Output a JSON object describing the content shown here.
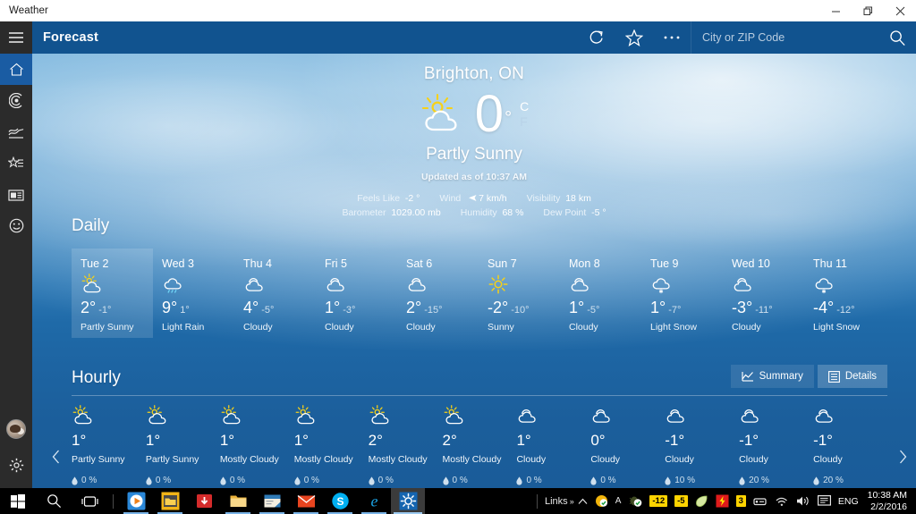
{
  "window": {
    "title": "Weather",
    "minimize_label": "Minimize",
    "restore_label": "Restore",
    "close_label": "Close"
  },
  "appbar": {
    "title": "Forecast",
    "hamburger_name": "hamburger-menu-icon",
    "refresh_name": "refresh-icon",
    "favorite_name": "star-icon",
    "more_name": "ellipsis-icon",
    "search_name": "search-icon"
  },
  "search": {
    "placeholder": "City or ZIP Code",
    "value": ""
  },
  "rail": {
    "items": [
      {
        "name": "home",
        "label": "Forecast",
        "icon": "home-icon",
        "active": true
      },
      {
        "name": "maps",
        "label": "Maps",
        "icon": "radar-icon",
        "active": false
      },
      {
        "name": "historical",
        "label": "Historical Weather",
        "icon": "chart-icon",
        "active": false
      },
      {
        "name": "favorites",
        "label": "Places",
        "icon": "star-list-icon",
        "active": false
      },
      {
        "name": "news",
        "label": "News",
        "icon": "news-icon",
        "active": false
      },
      {
        "name": "feedback",
        "label": "Send Feedback",
        "icon": "smiley-icon",
        "active": false
      }
    ],
    "account_name": "account-avatar",
    "settings_name": "gear-icon"
  },
  "current": {
    "city": "Brighton, ON",
    "temperature": "0",
    "degree": "°",
    "unit_selected": "C",
    "unit_alternate": "F",
    "condition": "Partly Sunny",
    "icon": "partly-sunny-icon",
    "updated": "Updated as of 10:37 AM",
    "details": [
      {
        "label": "Feels Like",
        "value": "-2 °"
      },
      {
        "label": "Wind",
        "value": "7 km/h",
        "arrow": true
      },
      {
        "label": "Visibility",
        "value": "18 km"
      },
      {
        "label": "Barometer",
        "value": "1029.00 mb"
      },
      {
        "label": "Humidity",
        "value": "68 %"
      },
      {
        "label": "Dew Point",
        "value": "-5 °"
      }
    ]
  },
  "daily": {
    "heading": "Daily",
    "days": [
      {
        "day": "Tue 2",
        "icon": "partly-sunny-icon",
        "high": "2°",
        "low": "-1°",
        "cond": "Partly Sunny",
        "selected": true
      },
      {
        "day": "Wed 3",
        "icon": "light-rain-icon",
        "high": "9°",
        "low": "1°",
        "cond": "Light Rain",
        "selected": false
      },
      {
        "day": "Thu 4",
        "icon": "cloudy-icon",
        "high": "4°",
        "low": "-5°",
        "cond": "Cloudy",
        "selected": false
      },
      {
        "day": "Fri 5",
        "icon": "cloudy-icon",
        "high": "1°",
        "low": "-3°",
        "cond": "Cloudy",
        "selected": false
      },
      {
        "day": "Sat 6",
        "icon": "cloudy-icon",
        "high": "2°",
        "low": "-15°",
        "cond": "Cloudy",
        "selected": false
      },
      {
        "day": "Sun 7",
        "icon": "sunny-icon",
        "high": "-2°",
        "low": "-10°",
        "cond": "Sunny",
        "selected": false
      },
      {
        "day": "Mon 8",
        "icon": "cloudy-icon",
        "high": "1°",
        "low": "-5°",
        "cond": "Cloudy",
        "selected": false
      },
      {
        "day": "Tue 9",
        "icon": "light-snow-icon",
        "high": "1°",
        "low": "-7°",
        "cond": "Light Snow",
        "selected": false
      },
      {
        "day": "Wed 10",
        "icon": "cloudy-icon",
        "high": "-3°",
        "low": "-11°",
        "cond": "Cloudy",
        "selected": false
      },
      {
        "day": "Thu 11",
        "icon": "light-snow-icon",
        "high": "-4°",
        "low": "-12°",
        "cond": "Light Snow",
        "selected": false
      }
    ]
  },
  "hourly": {
    "heading": "Hourly",
    "summary_label": "Summary",
    "details_label": "Details",
    "summary_icon": "line-chart-icon",
    "details_icon": "list-details-icon",
    "prev_arrow": "chevron-left-icon",
    "next_arrow": "chevron-right-icon",
    "hours": [
      {
        "icon": "partly-sunny-icon",
        "temp": "1°",
        "cond": "Partly Sunny",
        "precip": "0 %"
      },
      {
        "icon": "partly-sunny-icon",
        "temp": "1°",
        "cond": "Partly Sunny",
        "precip": "0 %"
      },
      {
        "icon": "partly-sunny-icon",
        "temp": "1°",
        "cond": "Mostly Cloudy",
        "precip": "0 %"
      },
      {
        "icon": "partly-sunny-icon",
        "temp": "1°",
        "cond": "Mostly Cloudy",
        "precip": "0 %"
      },
      {
        "icon": "partly-sunny-icon",
        "temp": "2°",
        "cond": "Mostly Cloudy",
        "precip": "0 %"
      },
      {
        "icon": "partly-sunny-icon",
        "temp": "2°",
        "cond": "Mostly Cloudy",
        "precip": "0 %"
      },
      {
        "icon": "cloudy-icon",
        "temp": "1°",
        "cond": "Cloudy",
        "precip": "0 %"
      },
      {
        "icon": "cloudy-icon",
        "temp": "0°",
        "cond": "Cloudy",
        "precip": "0 %"
      },
      {
        "icon": "cloudy-icon",
        "temp": "-1°",
        "cond": "Cloudy",
        "precip": "10 %"
      },
      {
        "icon": "cloudy-icon",
        "temp": "-1°",
        "cond": "Cloudy",
        "precip": "20 %"
      },
      {
        "icon": "cloudy-icon",
        "temp": "-1°",
        "cond": "Cloudy",
        "precip": "20 %"
      }
    ]
  },
  "taskbar": {
    "start_name": "windows-start-icon",
    "search_name": "taskbar-search-icon",
    "taskview_name": "task-view-icon",
    "apps": [
      {
        "name": "media-player",
        "open": false
      },
      {
        "name": "file-explorer-yellow",
        "open": true
      },
      {
        "name": "download-manager",
        "open": false
      },
      {
        "name": "file-explorer",
        "open": true
      },
      {
        "name": "sticky-notes",
        "open": true
      },
      {
        "name": "mail",
        "open": true
      },
      {
        "name": "skype",
        "open": true
      },
      {
        "name": "internet-explorer",
        "open": true
      },
      {
        "name": "weather",
        "open": true,
        "active": true
      }
    ],
    "links_label": "Links",
    "links_chevron": "»",
    "tray_expand": "^",
    "language": "ENG",
    "badges": [
      {
        "text": "-12",
        "style": "yellow"
      },
      {
        "text": "-5",
        "style": "yellow"
      },
      {
        "text": "3",
        "style": "yellow"
      }
    ],
    "clock_time": "10:38 AM",
    "clock_date": "2/2/2016",
    "action_center_name": "action-center-icon",
    "volume_name": "volume-icon",
    "network_name": "wifi-icon"
  },
  "colors": {
    "appbar": "#11538f",
    "rail": "#2b2b2b",
    "rail_active": "#1a5ca3",
    "sky_top": "#7cb6de",
    "sky_bottom": "#1a5c99",
    "accent_yellow": "#ffd400"
  }
}
